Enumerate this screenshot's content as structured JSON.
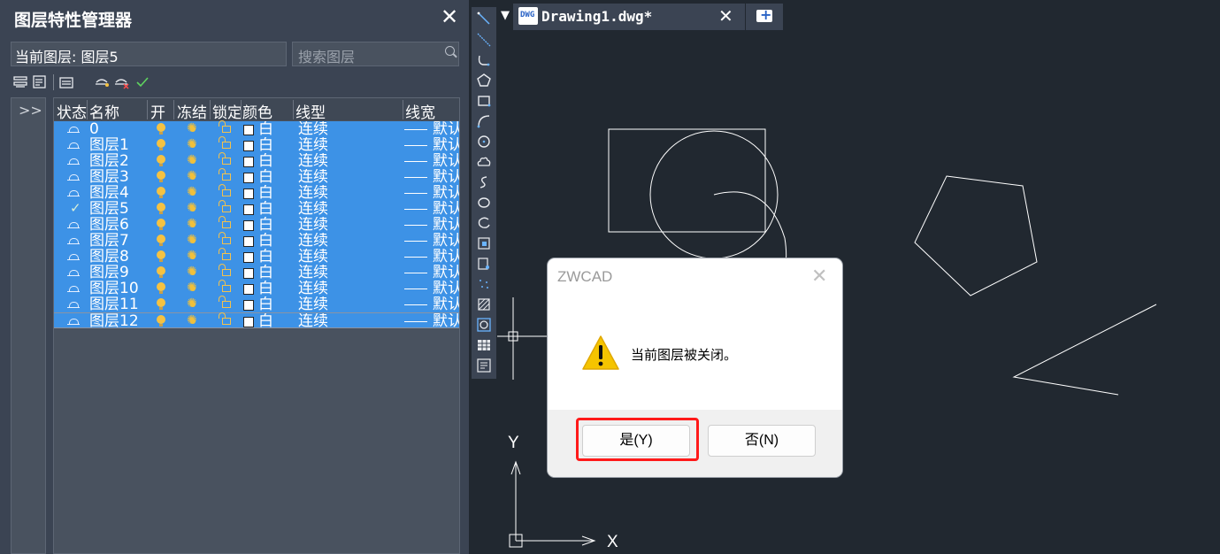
{
  "panel": {
    "title": "图层特性管理器",
    "close_glyph": "✕",
    "current_layer": "当前图层: 图层5",
    "search_placeholder": "搜索图层",
    "expander_glyph": ">>",
    "toolbar_icons": [
      "new-layer-icon",
      "new-layer-frozen-icon",
      "layer-states-icon",
      "set-current-off-icon",
      "delete-layer-icon",
      "set-current-check-icon"
    ]
  },
  "table": {
    "headers": [
      "状态",
      "名称",
      "开",
      "冻结",
      "锁定",
      "颜色",
      "线型",
      "线宽"
    ],
    "rows": [
      {
        "name": "0",
        "color": "白",
        "linetype": "连续",
        "lineweight": "默认",
        "current": false
      },
      {
        "name": "图层1",
        "color": "白",
        "linetype": "连续",
        "lineweight": "默认",
        "current": false
      },
      {
        "name": "图层2",
        "color": "白",
        "linetype": "连续",
        "lineweight": "默认",
        "current": false
      },
      {
        "name": "图层3",
        "color": "白",
        "linetype": "连续",
        "lineweight": "默认",
        "current": false
      },
      {
        "name": "图层4",
        "color": "白",
        "linetype": "连续",
        "lineweight": "默认",
        "current": false
      },
      {
        "name": "图层5",
        "color": "白",
        "linetype": "连续",
        "lineweight": "默认",
        "current": true
      },
      {
        "name": "图层6",
        "color": "白",
        "linetype": "连续",
        "lineweight": "默认",
        "current": false
      },
      {
        "name": "图层7",
        "color": "白",
        "linetype": "连续",
        "lineweight": "默认",
        "current": false
      },
      {
        "name": "图层8",
        "color": "白",
        "linetype": "连续",
        "lineweight": "默认",
        "current": false
      },
      {
        "name": "图层9",
        "color": "白",
        "linetype": "连续",
        "lineweight": "默认",
        "current": false
      },
      {
        "name": "图层10",
        "color": "白",
        "linetype": "连续",
        "lineweight": "默认",
        "current": false
      },
      {
        "name": "图层11",
        "color": "白",
        "linetype": "连续",
        "lineweight": "默认",
        "current": false
      },
      {
        "name": "图层12",
        "color": "白",
        "linetype": "连续",
        "lineweight": "默认",
        "current": false
      }
    ]
  },
  "toolbar": {
    "icons": [
      "line-icon",
      "xline-icon",
      "polyline-icon",
      "polygon-icon",
      "rectangle-icon",
      "arc-icon",
      "circle-icon",
      "revcloud-icon",
      "spline-icon",
      "ellipse-icon",
      "ellipse-arc-icon",
      "insert-block-icon",
      "make-block-icon",
      "point-icon",
      "hatch-icon",
      "region-icon",
      "table-icon",
      "mtext-icon"
    ]
  },
  "tabs": {
    "dropdown_glyph": "▼",
    "file_icon_text": "DWG",
    "drawing_name": "Drawing1.dwg*",
    "close_glyph": "✕"
  },
  "canvas": {
    "axis_y_label": "Y",
    "axis_x_label": "X"
  },
  "dialog": {
    "title": "ZWCAD",
    "close_glyph": "✕",
    "message": "当前图层被关闭。",
    "yes_label": "是(Y)",
    "no_label": "否(N)",
    "highlight_color": "#ff1a1a"
  },
  "colors": {
    "panel_bg": "#3b4453",
    "canvas_bg": "#212830",
    "row_selected": "#3d92e6",
    "warning_yellow": "#f5c400"
  }
}
